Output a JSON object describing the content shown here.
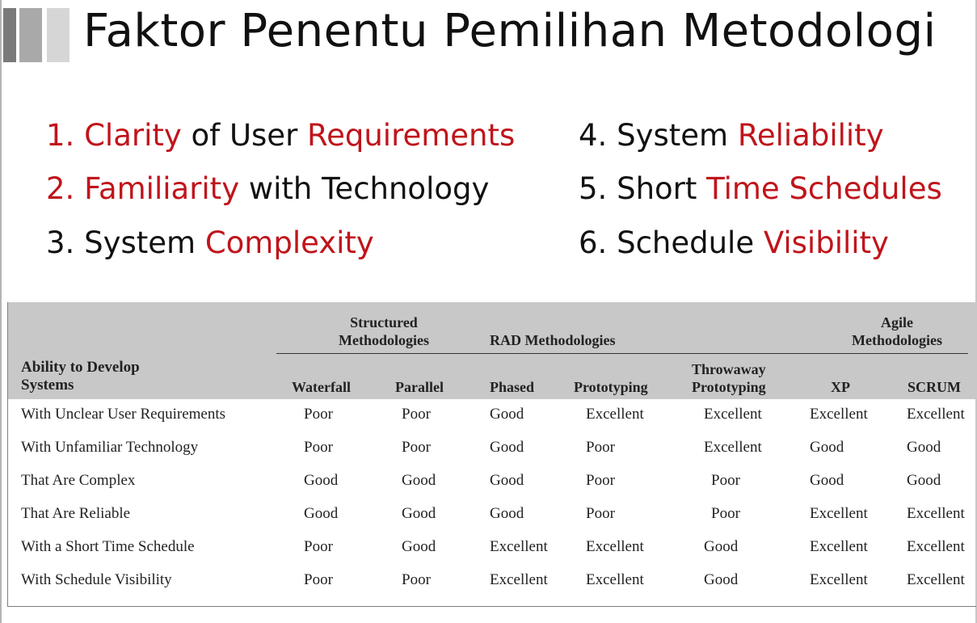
{
  "title": "Faktor Penentu Pemilihan Metodologi",
  "factors": [
    {
      "num": "1.",
      "parts": [
        {
          "t": "Clarity",
          "hl": true
        },
        {
          "t": " of User ",
          "hl": false
        },
        {
          "t": "Requirements",
          "hl": true
        }
      ],
      "num_hl": true
    },
    {
      "num": "2.",
      "parts": [
        {
          "t": "Familiarity",
          "hl": true
        },
        {
          "t": " with Technology",
          "hl": false
        }
      ],
      "num_hl": true
    },
    {
      "num": "3.",
      "parts": [
        {
          "t": "System ",
          "hl": false
        },
        {
          "t": "Complexity",
          "hl": true
        }
      ],
      "num_hl": false
    },
    {
      "num": "4.",
      "parts": [
        {
          "t": "System ",
          "hl": false
        },
        {
          "t": "Reliability",
          "hl": true
        }
      ],
      "num_hl": false
    },
    {
      "num": "5.",
      "parts": [
        {
          "t": "Short ",
          "hl": false
        },
        {
          "t": "Time Schedules",
          "hl": true
        }
      ],
      "num_hl": false
    },
    {
      "num": "6.",
      "parts": [
        {
          "t": "Schedule ",
          "hl": false
        },
        {
          "t": "Visibility",
          "hl": true
        }
      ],
      "num_hl": false
    }
  ],
  "colors": {
    "highlight": "#c0141b",
    "text": "#111111",
    "header_bg": "#c8c8c8"
  },
  "table": {
    "ability_label": "Ability to Develop\nSystems",
    "groups": {
      "structured": "Structured\nMethodologies",
      "rad": "RAD Methodologies",
      "agile": "Agile\nMethodologies"
    },
    "columns": [
      "Waterfall",
      "Parallel",
      "Phased",
      "Prototyping",
      "Throwaway\nPrototyping",
      "XP",
      "SCRUM"
    ],
    "rows": [
      {
        "label": "With Unclear User Requirements",
        "values": [
          "Poor",
          "Poor",
          "Good",
          "Excellent",
          "Excellent",
          "Excellent",
          "Excellent"
        ]
      },
      {
        "label": "With Unfamiliar Technology",
        "values": [
          "Poor",
          "Poor",
          "Good",
          "Poor",
          "Excellent",
          "Good",
          "Good"
        ]
      },
      {
        "label": "That Are Complex",
        "values": [
          "Good",
          "Good",
          "Good",
          "Poor",
          "Poor",
          "Good",
          "Good"
        ]
      },
      {
        "label": "That Are Reliable",
        "values": [
          "Good",
          "Good",
          "Good",
          "Poor",
          "Poor",
          "Excellent",
          "Excellent"
        ]
      },
      {
        "label": "With a Short Time Schedule",
        "values": [
          "Poor",
          "Good",
          "Excellent",
          "Excellent",
          "Good",
          "Excellent",
          "Excellent"
        ]
      },
      {
        "label": "With Schedule Visibility",
        "values": [
          "Poor",
          "Poor",
          "Excellent",
          "Excellent",
          "Good",
          "Excellent",
          "Excellent"
        ]
      }
    ]
  }
}
